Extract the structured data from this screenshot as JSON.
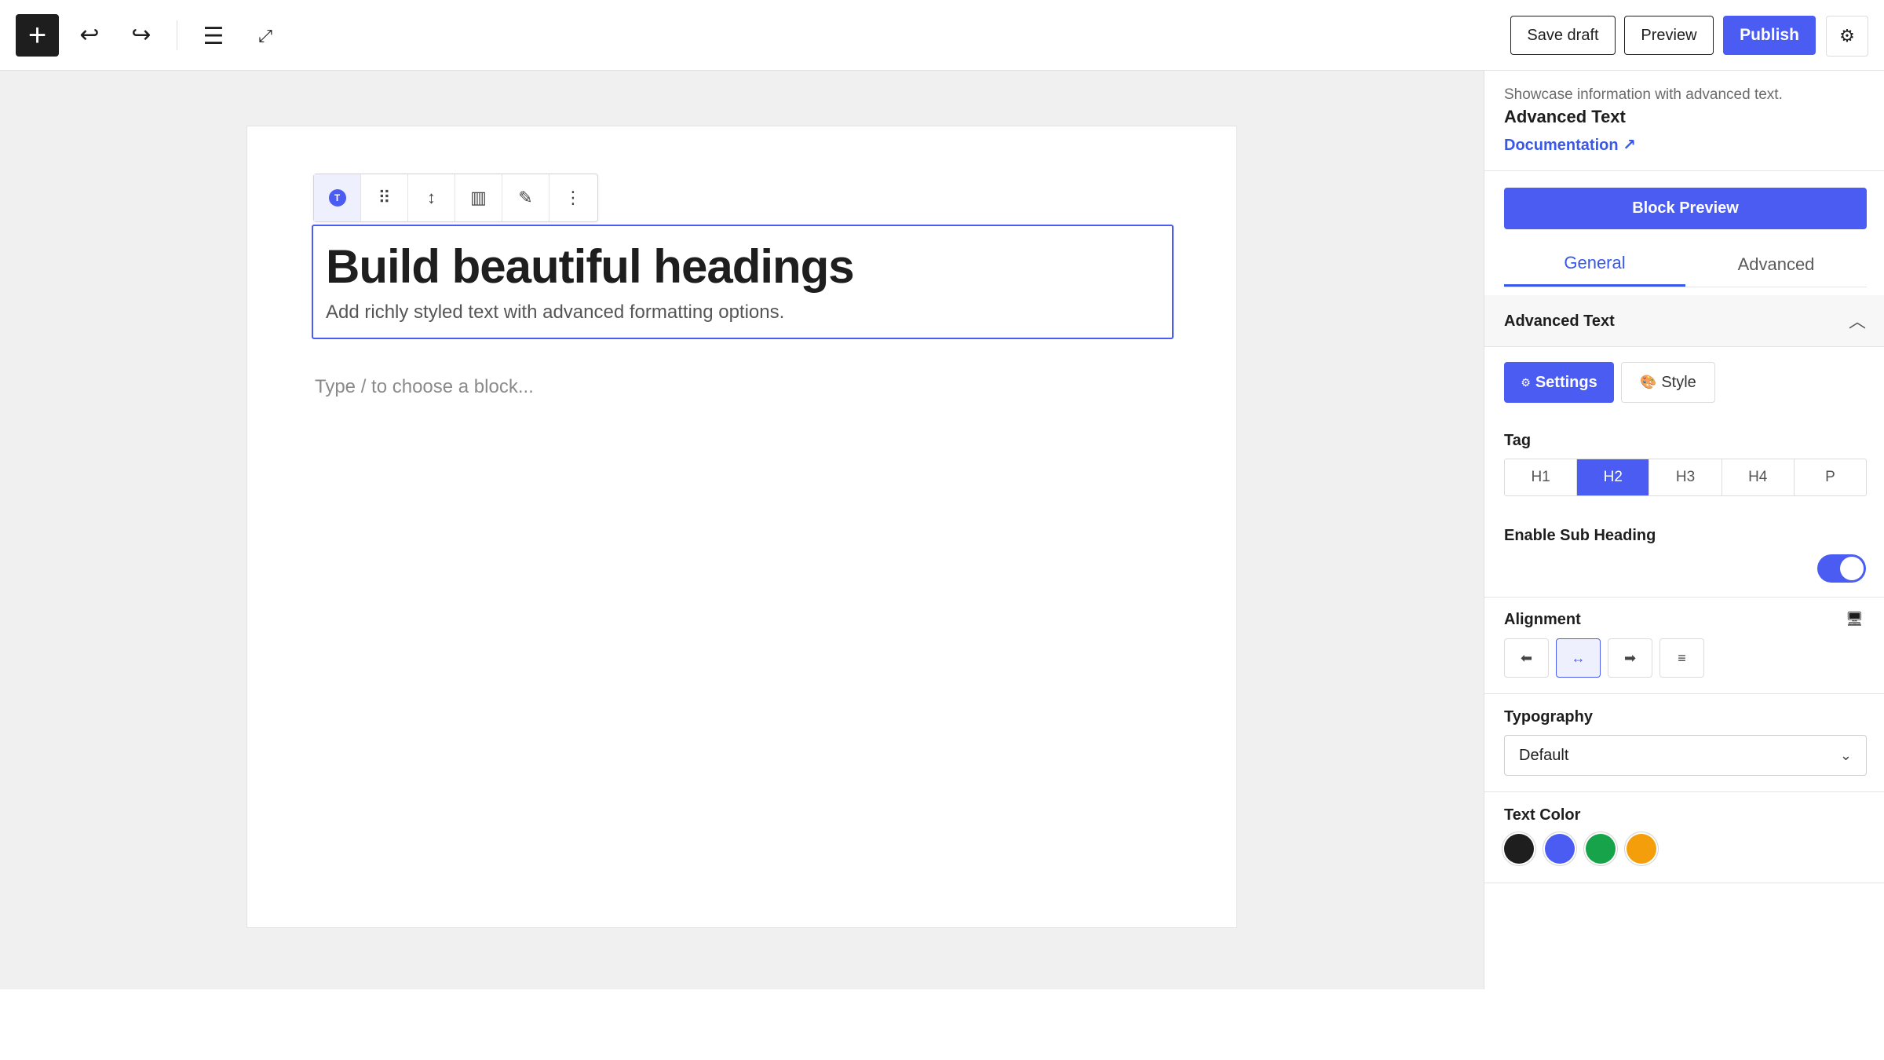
{
  "toolbar": {
    "add_icon": "+",
    "undo_icon": "↩",
    "redo_icon": "↪",
    "list_view_icon": "☰",
    "fullscreen_icon": "⤢",
    "save_draft_label": "Save draft",
    "preview_label": "Preview",
    "publish_label": "Publish",
    "settings_icon": "⚙"
  },
  "block_toolbar": {
    "type_letter": "T",
    "drag_icon": "⠿",
    "move_icon": "↕",
    "align_icon": "▥",
    "edit_icon": "✎",
    "more_icon": "⋮"
  },
  "editor": {
    "heading": "Build beautiful headings",
    "subheading": "Add richly styled text with advanced formatting options.",
    "placeholder": "Type / to choose a block..."
  },
  "sidebar": {
    "description": "Showcase information with advanced text.",
    "block_title": "Advanced Text",
    "doc_link": "Documentation ↗",
    "block_preview_label": "Block Preview",
    "tabs": [
      {
        "label": "General",
        "active": true
      },
      {
        "label": "Advanced",
        "active": false
      }
    ],
    "panel_title": "Advanced Text",
    "panel_chevron": "︿",
    "settings_icon": "⚙",
    "settings_label": "Settings",
    "style_icon": "🎨",
    "style_label": "Style",
    "tag_label": "Tag",
    "tags": [
      "H1",
      "H2",
      "H3",
      "H4",
      "P"
    ],
    "active_tag": "H2",
    "sub_heading_label": "Enable Sub Heading",
    "sub_heading_enabled": true,
    "alignment_label": "Alignment",
    "alignment_device_icon": "🖥",
    "alignment_icons": [
      "⬅",
      "↔",
      "➡",
      "≡"
    ],
    "active_alignment": 1,
    "typography_label": "Typography",
    "typography_value": "Default",
    "select_chevron": "⌄",
    "text_color_label": "Text Color",
    "colors": [
      "#1e1e1e",
      "#4b5cf2",
      "#16a34a",
      "#f59e0b"
    ]
  },
  "theme": {
    "accent": "#4b5cf2",
    "link": "#3858e9"
  }
}
